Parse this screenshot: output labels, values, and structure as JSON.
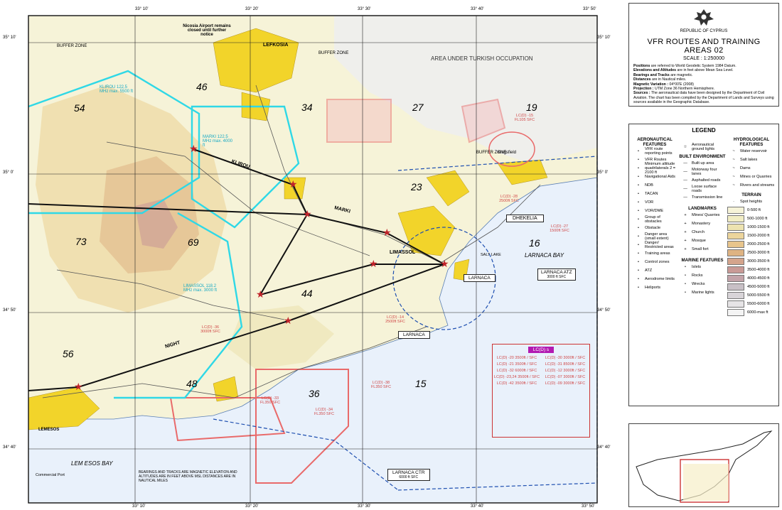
{
  "title_panel": {
    "republic": "REPUBLIC OF CYPRUS",
    "title": "VFR ROUTES AND TRAINING AREAS 02",
    "scale": "SCALE : 1:250000",
    "notes": [
      {
        "k": "Positions",
        "v": " are referred to World Geodetic System 1984 Datum."
      },
      {
        "k": "Elevations and Altitudes",
        "v": " are in feet above Mean Sea Level."
      },
      {
        "k": "Bearings and Tracks",
        "v": " are magnetic."
      },
      {
        "k": "Distances",
        "v": " are in Nautical miles."
      },
      {
        "k": "Magnetic Variation :",
        "v": " 04°00'E (2008)"
      },
      {
        "k": "Projection :",
        "v": " UTM Zone 36 Northern Hemisphere."
      },
      {
        "k": "Sources :",
        "v": " The aeronautical data have been designed by the Department of Civil Aviation. The chart has been compiled by the Department of Lands and Surveys using sources available in the Geographic Database."
      }
    ]
  },
  "legend": {
    "title": "LEGEND",
    "aero_head": "AERONAUTICAL FEATURES",
    "built_head": "BUILT ENVIRONMENT",
    "hydro_head": "HYDROLOGICAL FEATURES",
    "terrain_head": "TERRAIN",
    "landmarks_head": "LANDMARKS",
    "marine_head": "MARINE FEATURES",
    "aero_items": [
      "VFR route reporting points",
      "VFR Routes",
      "Minimum altitude quadrilaterals 2 = 2100 ft",
      "Navigational Aids",
      "NDB",
      "TACAN",
      "VOR",
      "VOR/DME",
      "Group of obstacles",
      "Obstacle",
      "Danger area (small extent)",
      "Danger/ Restricted areas",
      "Training areas",
      "Control zones",
      "ATZ",
      "Aerodrome limits",
      "Heliports"
    ],
    "aero2_items": [
      "Aeronautical ground lights"
    ],
    "built_items": [
      "Built up area",
      "Motorway four lanes",
      "Asphalted roads",
      "Loose surface roads",
      "Transmission line"
    ],
    "hydro_items": [
      "Water reservoir",
      "Salt lakes",
      "Dams",
      "Mines or Quarries",
      "Rivers and streams"
    ],
    "landmark_items": [
      "Mines/ Quarries",
      "Monastery",
      "Church",
      "Mosque",
      "Small fort"
    ],
    "marine_items": [
      "Islets",
      "Rocks",
      "Wrecks",
      "Marine lights"
    ],
    "spot_heights": "Spot heights",
    "terrain_bands": [
      {
        "label": "0-500 ft",
        "color": "#f6f3d8"
      },
      {
        "label": "500-1000 ft",
        "color": "#f1edc4"
      },
      {
        "label": "1000-1500 ft",
        "color": "#ede3b0"
      },
      {
        "label": "1500-2000 ft",
        "color": "#ecd59c"
      },
      {
        "label": "2000-2500 ft",
        "color": "#e8c58c"
      },
      {
        "label": "2500-3000 ft",
        "color": "#deb383"
      },
      {
        "label": "3000-3500 ft",
        "color": "#d4a48c"
      },
      {
        "label": "3500-4000 ft",
        "color": "#c99a96"
      },
      {
        "label": "4000-4500 ft",
        "color": "#c3a3a9"
      },
      {
        "label": "4500-5000 ft",
        "color": "#c8c0c6"
      },
      {
        "label": "5000-5500 ft",
        "color": "#d8d4d8"
      },
      {
        "label": "5500-6000 ft",
        "color": "#e6e4e6"
      },
      {
        "label": "6000-max ft",
        "color": "#f4f4f4"
      }
    ]
  },
  "map": {
    "grid_top": [
      "33° 10'",
      "33° 20'",
      "33° 30'",
      "33° 40'",
      "33° 50'"
    ],
    "grid_bottom": [
      "33° 10'",
      "33° 20'",
      "33° 30'",
      "33° 40'",
      "33° 50'"
    ],
    "grid_left": [
      "35° 10'",
      "35° 0'",
      "34° 50'",
      "34° 40'"
    ],
    "grid_right": [
      "35° 10'",
      "35° 0'",
      "34° 50'",
      "34° 40'"
    ],
    "area_labels": {
      "buffer1": "BUFFER ZONE",
      "buffer2": "BUFFER ZONE",
      "buffer3": "BUFFER ZONE",
      "occupation": "AREA   UNDER   TURKISH   OCCUPATION",
      "nicosia_airport": "Nicosia Airport remains closed until further notice",
      "lefkosia": "LEFKOSIA",
      "dhekelia_box": "DHEKELIA",
      "larnaca_bay": "LARNACA   BAY",
      "lemesos_bay": "LEM ESOS   BAY",
      "lemesos": "LEMESOS",
      "salt_lake": "SALT LAKE",
      "larnaca_atz": "LARNACA ATZ",
      "larnaca_atz_alt": "3000 ft SFC",
      "larnaca_ctr": "LARNACA CTR",
      "larnaca_ctr_alt": "6000 ft SFC",
      "larnaca_vor": "LARNACA",
      "larnaca_ndb": "LARNACA",
      "commercial_port": "Commercial Port",
      "kingsfield": "Kingsfield",
      "klirou": "KLIROU",
      "limassol": "LIMASSOL",
      "night": "NIGHT",
      "marki": "MARKI",
      "bearing_note": "BEARINGS AND TRACKS ARE MAGNETIC ELEVATION AND ALTITUDES ARE IN FEET ABOVE MSL DISTANCES ARE IN NAUTICAL MILES"
    },
    "quadrant_numbers": [
      "54",
      "46",
      "34",
      "27",
      "19",
      "23",
      "16",
      "73",
      "69",
      "44",
      "56",
      "48",
      "36",
      "15"
    ],
    "training_labels": [
      "KLIROU 122.5 MHz max. 5500 ft",
      "MARKI 122.5 MHz max. 4000 ft",
      "LIMASSOL 118.2 MHz max. 3000 ft"
    ],
    "lcd_box_title": "LC(D) s",
    "lcd_list": [
      "LC(D) -20 3500ft / SFC",
      "LC(D) -30 3000ft / SFC",
      "LC(D) -21 3500ft / SFC",
      "LC(D) -31 8500ft / SFC",
      "LC(D) -32 6000ft / SFC",
      "LC(D) -12 3000ft / SFC",
      "LC(D) -23,24 3500ft / SFC",
      "LC(D) -07 3000ft / SFC",
      "LC(D) -42 3500ft / SFC",
      "LC(D) -09 3000ft / SFC"
    ],
    "danger_labels": [
      "LC(D) -15 FL105 SFC",
      "LC(D) -28 2500ft SFC",
      "LC(D) -27 1500ft SFC",
      "LC(D) -38 FL350 SFC",
      "LC(D) -34 FL350 SFC",
      "LC(D) -33 FL350 SFC",
      "LC(D) -14 2500ft SFC",
      "LC(D) -36 3000ft SFC"
    ]
  },
  "colors": {
    "terrain_low": "#f6f3d8",
    "built_up": "#f2d42a",
    "sea": "#e9f1fb",
    "occupation": "#eeeeee",
    "training": "#2fd8e6",
    "danger": "#e96a6a",
    "route": "#111111",
    "control": "#1e4fb0"
  }
}
